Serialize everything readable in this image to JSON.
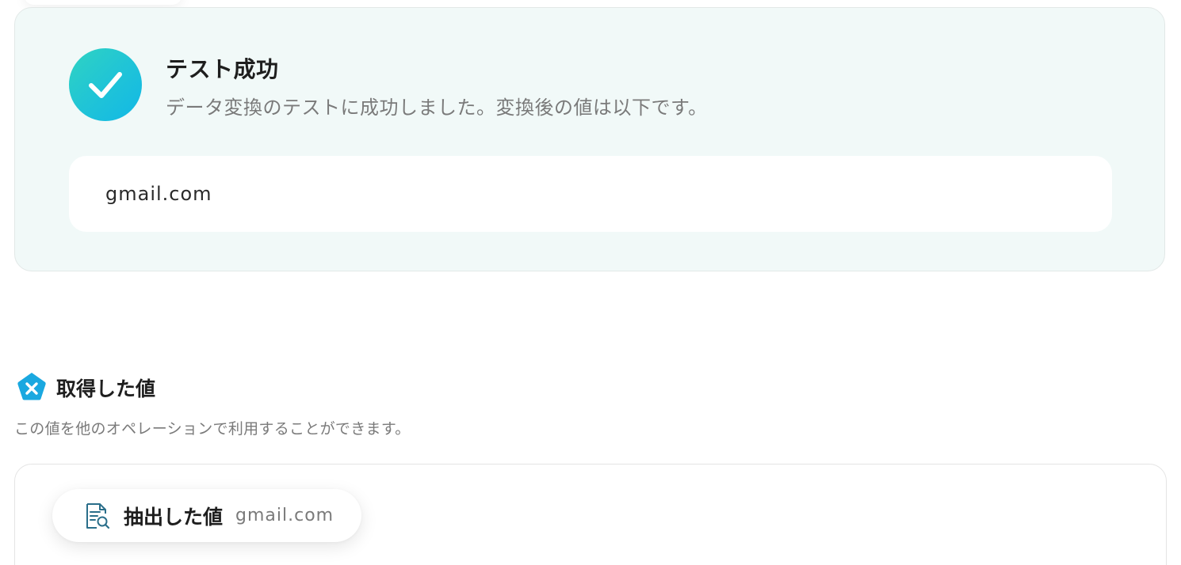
{
  "success": {
    "title": "テスト成功",
    "description": "データ変換のテストに成功しました。変換後の値は以下です。",
    "result_value": "gmail.com"
  },
  "obtained": {
    "title": "取得した値",
    "description": "この値を他のオペレーションで利用することができます。",
    "chip": {
      "label": "抽出した値",
      "value": "gmail.com"
    }
  },
  "icons": {
    "success": "check-icon",
    "section": "variable-pentagon-icon",
    "chip": "document-search-icon"
  },
  "colors": {
    "success_panel_bg": "#f1f9f8",
    "accent_teal": "#1fc3d8",
    "section_icon": "#1aa8e0"
  }
}
